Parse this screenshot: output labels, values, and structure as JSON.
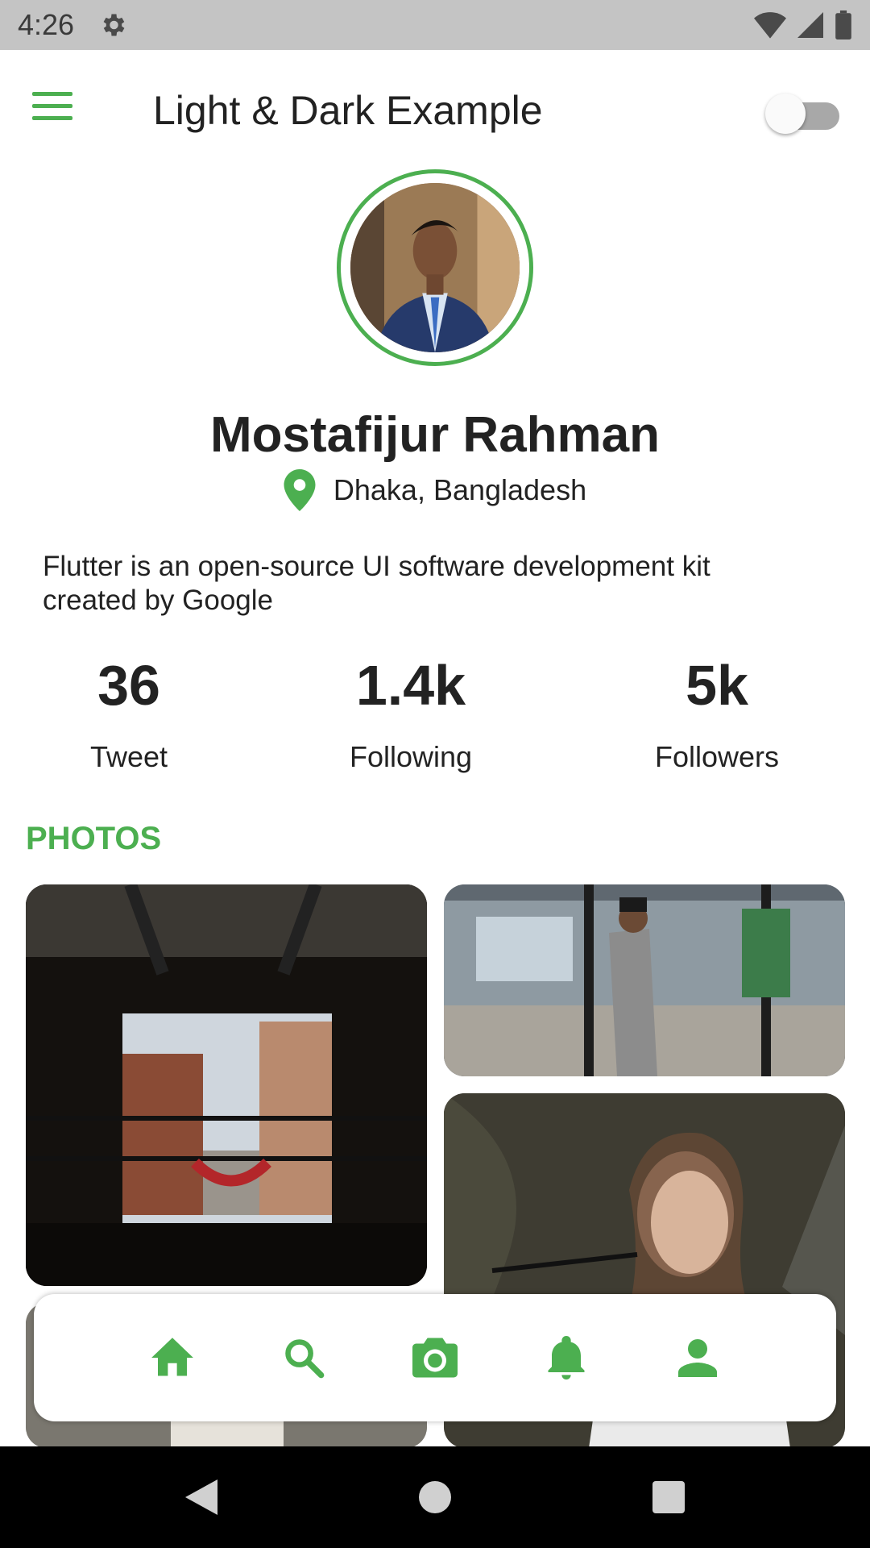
{
  "status_bar": {
    "time": "4:26",
    "icons": [
      "settings-icon",
      "wifi-icon",
      "signal-icon",
      "battery-icon"
    ]
  },
  "app_bar": {
    "title": "Light & Dark Example",
    "menu_icon": "menu-icon",
    "theme_toggle": "off"
  },
  "profile": {
    "name": "Mostafijur Rahman",
    "location": "Dhaka, Bangladesh",
    "bio": "Flutter is an open-source UI software development kit created by Google"
  },
  "stats": [
    {
      "value": "36",
      "label": "Tweet"
    },
    {
      "value": "1.4k",
      "label": "Following"
    },
    {
      "value": "5k",
      "label": "Followers"
    }
  ],
  "photos": {
    "heading": "PHOTOS"
  },
  "bottom_nav": {
    "items": [
      "home-icon",
      "search-icon",
      "camera-icon",
      "notifications-icon",
      "profile-icon"
    ]
  },
  "system_nav": {
    "items": [
      "back-icon",
      "home-circle-icon",
      "recents-icon"
    ]
  },
  "colors": {
    "accent": "#4caf50",
    "status_bar": "#c4c4c4",
    "system_nav": "#000000"
  }
}
